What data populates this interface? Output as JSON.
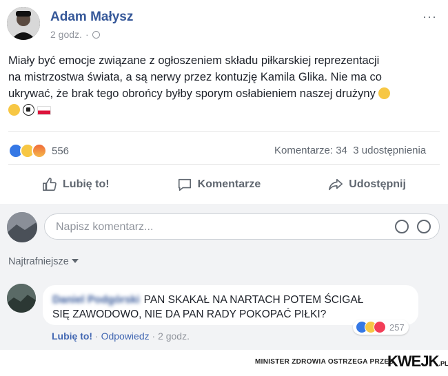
{
  "post": {
    "author": "Adam Małysz",
    "time": "2 godz.",
    "more_menu": "···",
    "text_lines": [
      "Miały być emocje związane z ogłoszeniem składu piłkarskiej reprezentacji",
      "na mistrzostwa świata, a są nerwy przez kontuzję Kamila Glika. Nie ma co",
      "ukrywać, że brak tego obrońcy byłby sporym osłabieniem naszej drużyny"
    ],
    "reactions_count": "556",
    "comments_count": "Komentarze: 34",
    "shares_count": "3 udostępnienia"
  },
  "actions": {
    "like": "Lubię to!",
    "comment": "Komentarze",
    "share": "Udostępnij"
  },
  "comment_box": {
    "placeholder": "Napisz komentarz..."
  },
  "sort_label": "Najtrafniejsze",
  "comment": {
    "author": "Daniel Podgórski",
    "line1": "PAN SKAKAŁ NA NARTACH  POTEM ŚCIGAŁ",
    "line2": "SIĘ ZAWODOWO, NIE DA PAN RADY POKOPAĆ PIŁKI?",
    "reaction_count": "257",
    "like": "Lubię to!",
    "sep": "·",
    "reply": "Odpowiedz",
    "time": "2 godz."
  },
  "footer": {
    "warning": "MINISTER ZDROWIA OSTRZEGA PRZED",
    "brand": "KWEJK",
    "brand_suffix": ".PL"
  },
  "colors": {
    "link": "#365899",
    "meta": "#90949c",
    "like_blue": "#3578e5"
  }
}
